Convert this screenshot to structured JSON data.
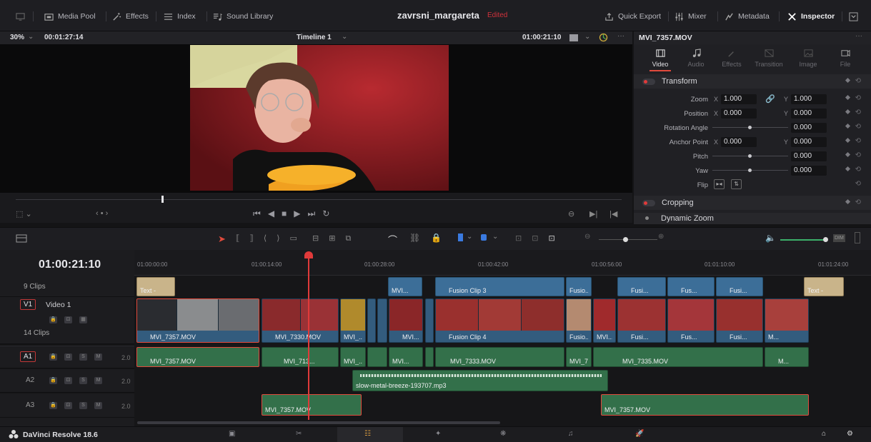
{
  "topbar": {
    "media_pool": "Media Pool",
    "effects": "Effects",
    "index": "Index",
    "sound_library": "Sound Library",
    "project_title": "zavrsni_margareta",
    "project_status": "Edited",
    "quick_export": "Quick Export",
    "mixer": "Mixer",
    "metadata": "Metadata",
    "inspector": "Inspector"
  },
  "viewer": {
    "zoom": "30%",
    "source_timecode": "00:01:27:14",
    "timeline_name": "Timeline 1",
    "record_timecode": "01:00:21:10",
    "playhead_progress": 0.24
  },
  "inspector": {
    "clip_name": "MVI_7357.MOV",
    "tabs": [
      "Video",
      "Audio",
      "Effects",
      "Transition",
      "Image",
      "File"
    ],
    "active_tab": "Video",
    "transform": {
      "title": "Transform",
      "zoom_label": "Zoom",
      "zoom_x": "1.000",
      "zoom_y": "1.000",
      "position_label": "Position",
      "position_x": "0.000",
      "position_y": "0.000",
      "rotation_label": "Rotation Angle",
      "rotation": "0.000",
      "anchor_label": "Anchor Point",
      "anchor_x": "0.000",
      "anchor_y": "0.000",
      "pitch_label": "Pitch",
      "pitch": "0.000",
      "yaw_label": "Yaw",
      "yaw": "0.000",
      "flip_label": "Flip",
      "x_axis": "X",
      "y_axis": "Y"
    },
    "cropping": "Cropping",
    "dynamic_zoom": "Dynamic Zoom"
  },
  "timeline": {
    "current_tc": "01:00:21:10",
    "ruler": [
      "01:00:00:00",
      "01:00:14:00",
      "01:00:28:00",
      "01:00:42:00",
      "01:00:56:00",
      "01:01:10:00",
      "01:01:24:00"
    ],
    "tracks": {
      "v2_clips": "9 Clips",
      "v1_badge": "V1",
      "v1_name": "Video 1",
      "v1_clips": "14 Clips",
      "a1_badge": "A1",
      "a2_badge": "A2",
      "a3_badge": "A3",
      "level": "2.0",
      "solo": "S",
      "mute": "M"
    },
    "v2": [
      {
        "label": "Text -"
      },
      {
        "label": "MVI..."
      },
      {
        "label": "Fusion Clip 3"
      },
      {
        "label": "Fusio..."
      },
      {
        "label": "Fusi..."
      },
      {
        "label": "Fus..."
      },
      {
        "label": "Fusi..."
      },
      {
        "label": "Text -"
      }
    ],
    "v1": [
      {
        "label": "MVI_7357.MOV"
      },
      {
        "label": "MVI_7330.MOV"
      },
      {
        "label": "MVI_..."
      },
      {
        "label": "MVI..."
      },
      {
        "label": "Fusion Clip 4"
      },
      {
        "label": "Fusio..."
      },
      {
        "label": "MVI..."
      },
      {
        "label": "Fusi..."
      },
      {
        "label": "Fus..."
      },
      {
        "label": "Fusi..."
      },
      {
        "label": "M..."
      }
    ],
    "a1": [
      {
        "label": "MVI_7357.MOV"
      },
      {
        "label": "MVI_713..."
      },
      {
        "label": "MVI_..."
      },
      {
        "label": "MVI..."
      },
      {
        "label": "MVI_7333.MOV"
      },
      {
        "label": "MVI_7..."
      },
      {
        "label": "MVI_7335.MOV"
      },
      {
        "label": "M..."
      }
    ],
    "a2": [
      {
        "label": "slow-metal-breeze-193707.mp3"
      }
    ],
    "a3": [
      {
        "label": "MVI_7357.MOV"
      },
      {
        "label": "MVI_7357.MOV"
      }
    ]
  },
  "footer": {
    "app_name": "DaVinci Resolve 18.6"
  },
  "colors": {
    "accent_red": "#e14a3c",
    "video_clip": "#335c7e",
    "audio_clip": "#33704a",
    "fusion_clip": "#3c6e98"
  }
}
